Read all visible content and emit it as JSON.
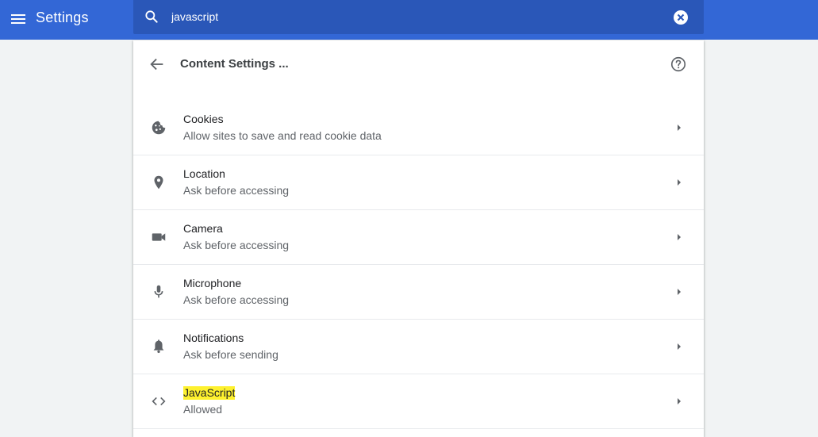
{
  "app": {
    "title": "Settings"
  },
  "search": {
    "value": "javascript"
  },
  "page": {
    "title": "Content Settings ..."
  },
  "rows": [
    {
      "title": "Cookies",
      "subtitle": "Allow sites to save and read cookie data",
      "icon": "cookie-icon"
    },
    {
      "title": "Location",
      "subtitle": "Ask before accessing",
      "icon": "location-pin-icon"
    },
    {
      "title": "Camera",
      "subtitle": "Ask before accessing",
      "icon": "camera-icon"
    },
    {
      "title": "Microphone",
      "subtitle": "Ask before accessing",
      "icon": "microphone-icon"
    },
    {
      "title": "Notifications",
      "subtitle": "Ask before sending",
      "icon": "bell-icon"
    },
    {
      "title": "JavaScript",
      "subtitle": "Allowed",
      "icon": "code-icon",
      "highlighted": true
    }
  ],
  "colors": {
    "topbar": "#3367d6",
    "searchbox": "#2a57b8",
    "highlight": "#fef12e",
    "icon": "#5f6368"
  }
}
